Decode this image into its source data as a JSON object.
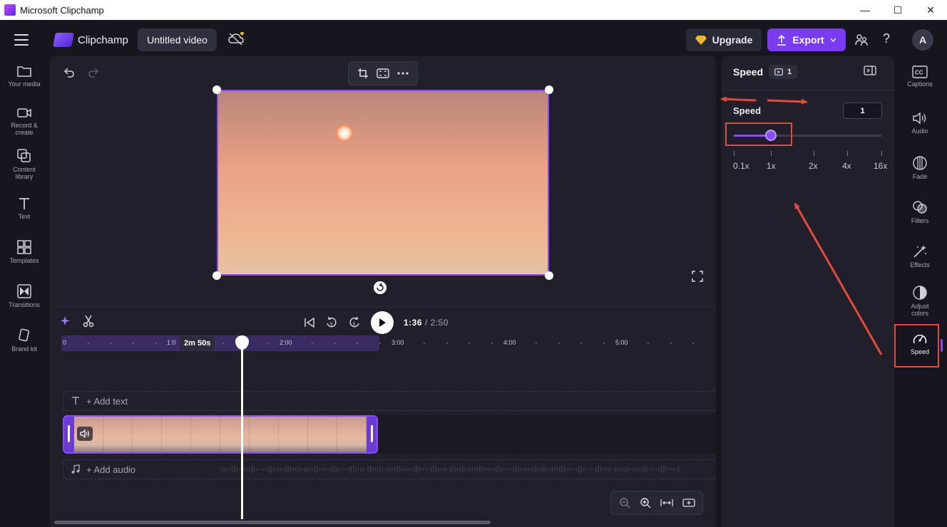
{
  "window": {
    "title": "Microsoft Clipchamp",
    "controls": [
      "minimize",
      "maximize",
      "close"
    ]
  },
  "header": {
    "brand": "Clipchamp",
    "video_title": "Untitled video",
    "upgrade_label": "Upgrade",
    "export_label": "Export",
    "avatar_initial": "A",
    "help_label": "?"
  },
  "left_sidebar": {
    "items": [
      {
        "label": "Your media",
        "icon": "folder-icon"
      },
      {
        "label": "Record & create",
        "icon": "camera-icon"
      },
      {
        "label": "Content library",
        "icon": "content-library-icon"
      },
      {
        "label": "Text",
        "icon": "text-icon"
      },
      {
        "label": "Templates",
        "icon": "templates-icon"
      },
      {
        "label": "Transitions",
        "icon": "transitions-icon"
      },
      {
        "label": "Brand kit",
        "icon": "brand-kit-icon"
      }
    ]
  },
  "timeline": {
    "current_time": "1:36",
    "total_time": "/ 2:50",
    "duration_badge": "2m 50s",
    "ruler_labels": [
      "0",
      "1:0",
      "2:00",
      "3:00",
      "4:00",
      "5:00"
    ],
    "add_text_label": "+ Add text",
    "add_audio_label": "+ Add audio"
  },
  "speed_panel": {
    "title": "Speed",
    "clip_count": "1",
    "section_label": "Speed",
    "value": "1",
    "slider_fraction": 0.25,
    "tick_labels": [
      "0.1x",
      "1x",
      "2x",
      "4x",
      "16x"
    ]
  },
  "right_rail": {
    "items": [
      {
        "label": "Captions",
        "icon": "captions-icon"
      },
      {
        "label": "Audio",
        "icon": "audio-icon"
      },
      {
        "label": "Fade",
        "icon": "fade-icon"
      },
      {
        "label": "Filters",
        "icon": "filters-icon"
      },
      {
        "label": "Effects",
        "icon": "effects-icon"
      },
      {
        "label": "Adjust colors",
        "icon": "adjust-colors-icon"
      },
      {
        "label": "Speed",
        "icon": "speed-icon"
      }
    ],
    "active": "Speed"
  },
  "colors": {
    "accent": "#8a4df5",
    "export_button": "#7a3cf0",
    "annotation": "#e24a3c",
    "background": "#17161f",
    "panel": "#201f2a"
  }
}
